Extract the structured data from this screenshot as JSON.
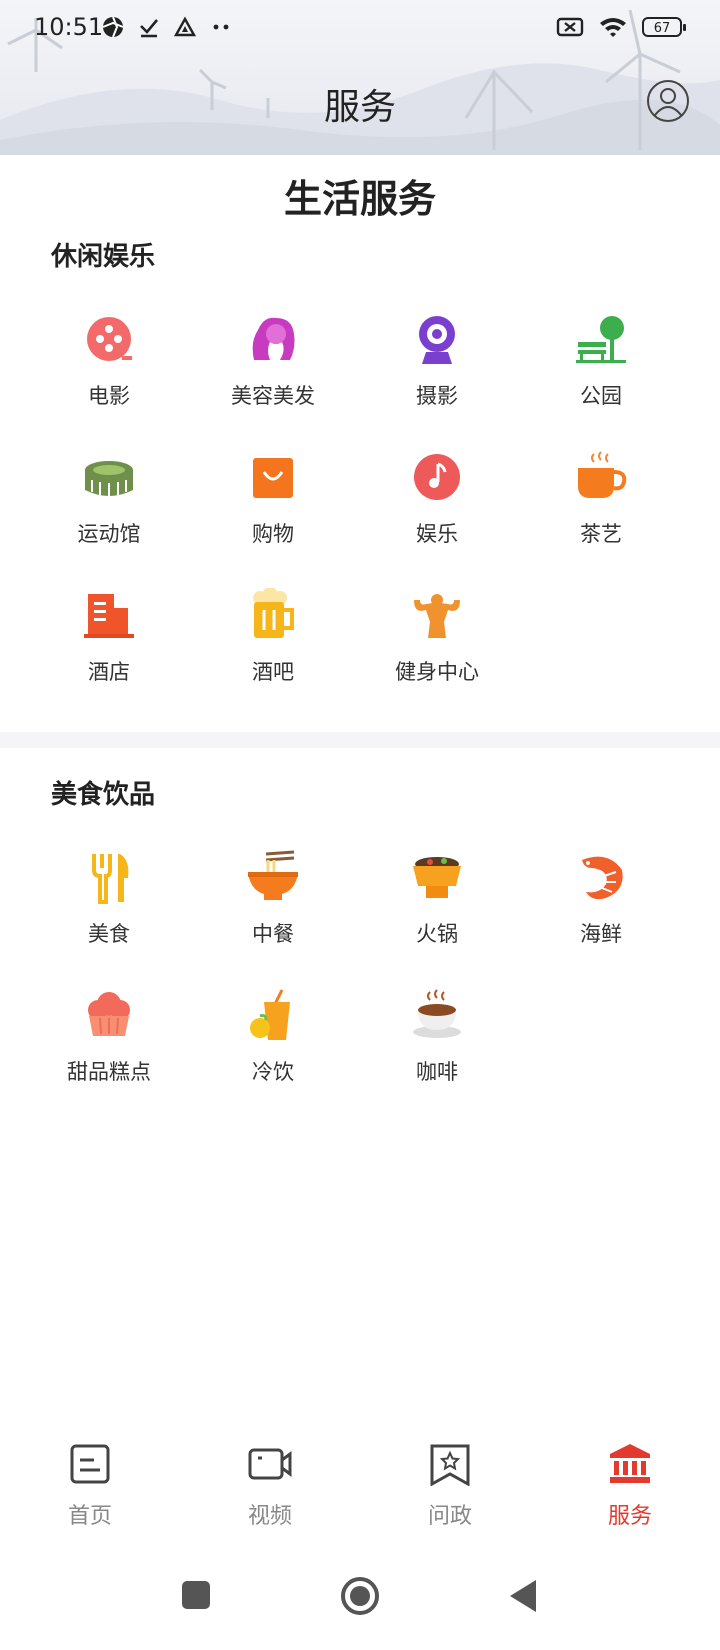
{
  "status_bar": {
    "time": "10:51",
    "battery": "67"
  },
  "header": {
    "title": "服务"
  },
  "page_heading": "生活服务",
  "sections": [
    {
      "title": "休闲娱乐",
      "items": [
        {
          "label": "电影",
          "icon": "film-reel-icon"
        },
        {
          "label": "美容美发",
          "icon": "hair-salon-icon"
        },
        {
          "label": "摄影",
          "icon": "camera-icon"
        },
        {
          "label": "公园",
          "icon": "park-bench-icon"
        },
        {
          "label": "运动馆",
          "icon": "stadium-icon"
        },
        {
          "label": "购物",
          "icon": "shopping-bag-icon"
        },
        {
          "label": "娱乐",
          "icon": "music-note-icon"
        },
        {
          "label": "茶艺",
          "icon": "tea-cup-icon"
        },
        {
          "label": "酒店",
          "icon": "hotel-icon"
        },
        {
          "label": "酒吧",
          "icon": "beer-mug-icon"
        },
        {
          "label": "健身中心",
          "icon": "fitness-icon"
        }
      ]
    },
    {
      "title": "美食饮品",
      "items": [
        {
          "label": "美食",
          "icon": "fork-knife-icon"
        },
        {
          "label": "中餐",
          "icon": "noodle-bowl-icon"
        },
        {
          "label": "火锅",
          "icon": "hotpot-icon"
        },
        {
          "label": "海鲜",
          "icon": "shrimp-icon"
        },
        {
          "label": "甜品糕点",
          "icon": "cupcake-icon"
        },
        {
          "label": "冷饮",
          "icon": "juice-icon"
        },
        {
          "label": "咖啡",
          "icon": "coffee-icon"
        }
      ]
    }
  ],
  "tabs": [
    {
      "label": "首页",
      "icon": "home-doc-icon",
      "active": false
    },
    {
      "label": "视频",
      "icon": "video-camera-icon",
      "active": false
    },
    {
      "label": "问政",
      "icon": "bookmark-star-icon",
      "active": false
    },
    {
      "label": "服务",
      "icon": "government-building-icon",
      "active": true
    }
  ],
  "colors": {
    "accent": "#e23a2e",
    "inactive_tab": "#888888"
  }
}
